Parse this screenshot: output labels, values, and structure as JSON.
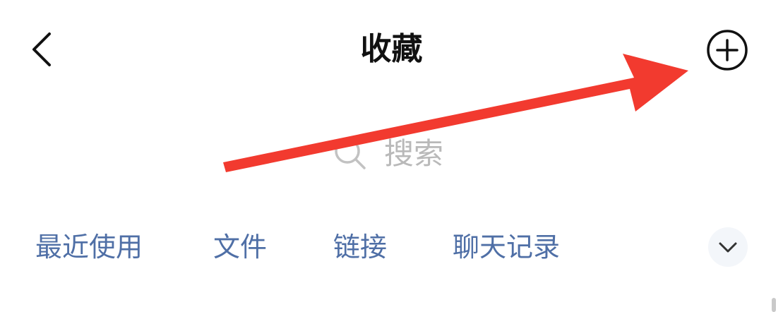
{
  "header": {
    "title": "收藏",
    "back_icon": "chevron-left-icon",
    "add_icon": "plus-circle-icon"
  },
  "search": {
    "placeholder": "搜索",
    "icon": "search-icon"
  },
  "tabs": [
    {
      "label": "最近使用"
    },
    {
      "label": "文件"
    },
    {
      "label": "链接"
    },
    {
      "label": "聊天记录"
    }
  ],
  "tabs_expand_icon": "chevron-down-icon",
  "colors": {
    "tab_text": "#4f6fa6",
    "placeholder": "#b9b9b9",
    "title": "#111111",
    "annotation_arrow": "#f23a2f"
  }
}
